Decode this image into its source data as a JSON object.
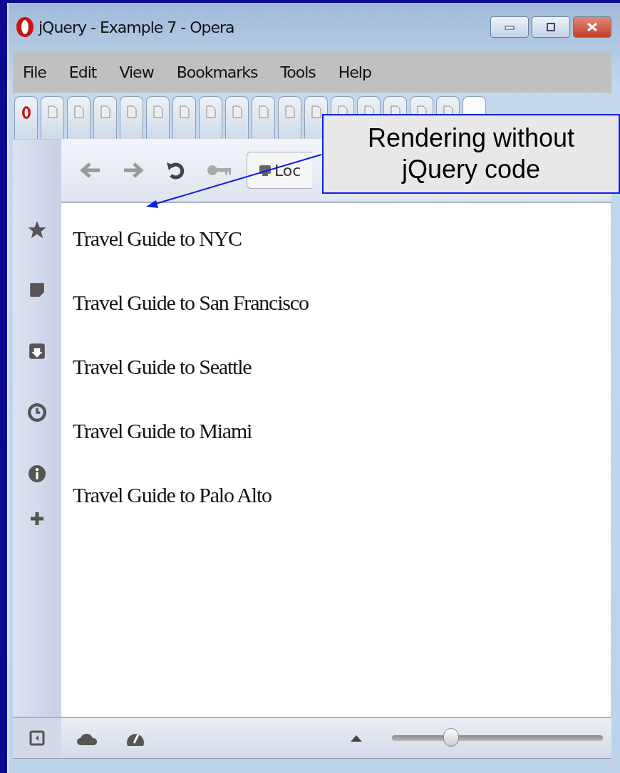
{
  "window": {
    "title": "jQuery - Example 7 - Opera"
  },
  "menu": [
    "File",
    "Edit",
    "View",
    "Bookmarks",
    "Tools",
    "Help"
  ],
  "tabs": [
    {
      "kind": "opera",
      "selected": false
    },
    {
      "kind": "page",
      "selected": false
    },
    {
      "kind": "page",
      "selected": false
    },
    {
      "kind": "page",
      "selected": false
    },
    {
      "kind": "page",
      "selected": false
    },
    {
      "kind": "page",
      "selected": false
    },
    {
      "kind": "page",
      "selected": false
    },
    {
      "kind": "page",
      "selected": false
    },
    {
      "kind": "page",
      "selected": false
    },
    {
      "kind": "page",
      "selected": false
    },
    {
      "kind": "page",
      "selected": false
    },
    {
      "kind": "page",
      "selected": false
    },
    {
      "kind": "page",
      "selected": false
    },
    {
      "kind": "page",
      "selected": false
    },
    {
      "kind": "page",
      "selected": false
    },
    {
      "kind": "page",
      "selected": false
    },
    {
      "kind": "page",
      "selected": false
    },
    {
      "kind": "blank",
      "selected": true
    }
  ],
  "address": {
    "value": "Loc"
  },
  "content": {
    "lines": [
      "Travel Guide to NYC",
      "Travel Guide to San Francisco",
      "Travel Guide to Seattle",
      "Travel Guide to Miami",
      "Travel Guide to Palo Alto"
    ]
  },
  "sidebar": {
    "items": [
      {
        "kind": "star"
      },
      {
        "kind": "note"
      },
      {
        "kind": "download"
      },
      {
        "kind": "clock"
      },
      {
        "kind": "info"
      },
      {
        "kind": "plus"
      }
    ]
  },
  "status_bar": {
    "zoom": {
      "level": 0.28
    }
  },
  "callout": {
    "text": "Rendering without jQuery code"
  }
}
